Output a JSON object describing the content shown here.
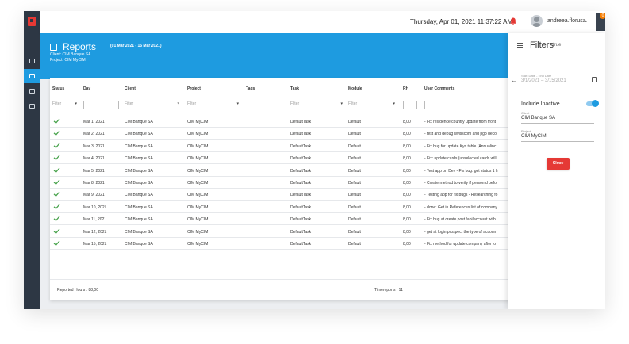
{
  "topbar": {
    "datetime": "Thursday, Apr 01, 2021  11:37:22 AM",
    "username": "andreea.florusa",
    "settings_badge": "0"
  },
  "nav": {
    "items": [
      "dashboard-icon",
      "reports-icon",
      "folder-icon",
      "people-icon"
    ],
    "active_index": 1
  },
  "report": {
    "title": "Reports",
    "range": "(01 Mar 2021 - 15 Mar 2021)",
    "client": "Client: CIM Banque SA",
    "project": "Project: CIM MyCIM"
  },
  "table": {
    "columns": [
      "Status",
      "Day",
      "Client",
      "Project",
      "Tags",
      "Task",
      "Module",
      "RH",
      "User Comments"
    ],
    "filter_placeholder": "Filter",
    "rows": [
      {
        "day": "Mar 1, 2021",
        "client": "CIM Banque SA",
        "project": "CIM MyCIM",
        "task": "DefaultTask",
        "module": "Default",
        "rh": "8,00",
        "comment": "- Fix residence country update from front"
      },
      {
        "day": "Mar 2, 2021",
        "client": "CIM Banque SA",
        "project": "CIM MyCIM",
        "task": "DefaultTask",
        "module": "Default",
        "rh": "8,00",
        "comment": "- test and debug swisscom and pgb deco"
      },
      {
        "day": "Mar 3, 2021",
        "client": "CIM Banque SA",
        "project": "CIM MyCIM",
        "task": "DefaultTask",
        "module": "Default",
        "rh": "8,00",
        "comment": "- Fix bug for update Kyc table (Annualinc"
      },
      {
        "day": "Mar 4, 2021",
        "client": "CIM Banque SA",
        "project": "CIM MyCIM",
        "task": "DefaultTask",
        "module": "Default",
        "rh": "8,00",
        "comment": "- Fix: update cards (unselected cards will"
      },
      {
        "day": "Mar 5, 2021",
        "client": "CIM Banque SA",
        "project": "CIM MyCIM",
        "task": "DefaultTask",
        "module": "Default",
        "rh": "8,00",
        "comment": "- Test app on Dev - Fix bug: get status 1 fr"
      },
      {
        "day": "Mar 8, 2021",
        "client": "CIM Banque SA",
        "project": "CIM MyCIM",
        "task": "DefaultTask",
        "module": "Default",
        "rh": "8,00",
        "comment": "- Create method to verify if personId befor"
      },
      {
        "day": "Mar 9, 2021",
        "client": "CIM Banque SA",
        "project": "CIM MyCIM",
        "task": "DefaultTask",
        "module": "Default",
        "rh": "8,00",
        "comment": "- Testing app for fix bugs - Researching fo"
      },
      {
        "day": "Mar 10, 2021",
        "client": "CIM Banque SA",
        "project": "CIM MyCIM",
        "task": "DefaultTask",
        "module": "Default",
        "rh": "8,00",
        "comment": "- done: Get in References list of company"
      },
      {
        "day": "Mar 11, 2021",
        "client": "CIM Banque SA",
        "project": "CIM MyCIM",
        "task": "DefaultTask",
        "module": "Default",
        "rh": "8,00",
        "comment": "- Fix bug at create post /api/account with"
      },
      {
        "day": "Mar 12, 2021",
        "client": "CIM Banque SA",
        "project": "CIM MyCIM",
        "task": "DefaultTask",
        "module": "Default",
        "rh": "8,00",
        "comment": "- get at login prospect the type of accoun"
      },
      {
        "day": "Mar 15, 2021",
        "client": "CIM Banque SA",
        "project": "CIM MyCIM",
        "task": "DefaultTask",
        "module": "Default",
        "rh": "8,00",
        "comment": "- Fix method for update company after lo"
      }
    ],
    "footer_hours": "Reported Hours : 88,00",
    "footer_timereports": "Timereports : 11"
  },
  "filters": {
    "title": "Filters",
    "title_suffix": "true",
    "date_label": "Start Date - End Date",
    "date_value": "3/1/2021 – 3/15/2021",
    "include_inactive_label": "Include Inactive",
    "include_inactive": true,
    "client_label": "Client",
    "client_value": "CIM Banque SA",
    "project_label": "Project",
    "project_value": "CIM MyCIM",
    "close_label": "Close"
  },
  "colors": {
    "accent": "#1e9be0",
    "sidebar": "#2d3744",
    "danger": "#e53935",
    "success": "#43a047"
  }
}
